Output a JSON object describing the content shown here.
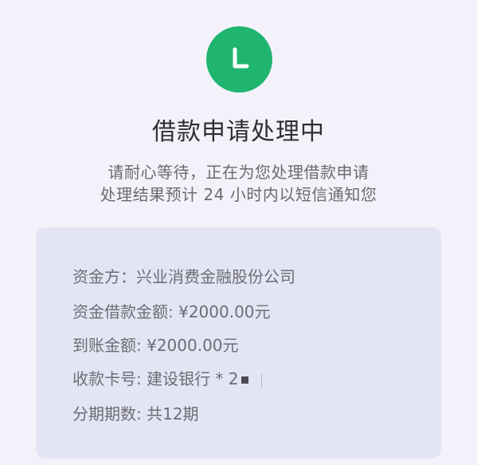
{
  "status": {
    "icon": "clock-icon",
    "icon_color": "#1fb56f"
  },
  "title": "借款申请处理中",
  "subtitle_line1": "请耐心等待，正在为您处理借款申请",
  "subtitle_line2": "处理结果预计 24 小时内以短信通知您",
  "details": {
    "lender": "资金方：兴业消费金融股份公司",
    "loan_amount": "资金借款金额: ¥2000.00元",
    "received_amount": "到账金额: ¥2000.00元",
    "card": "收款卡号: 建设银行 * 2",
    "installments": "分期期数: 共12期"
  }
}
